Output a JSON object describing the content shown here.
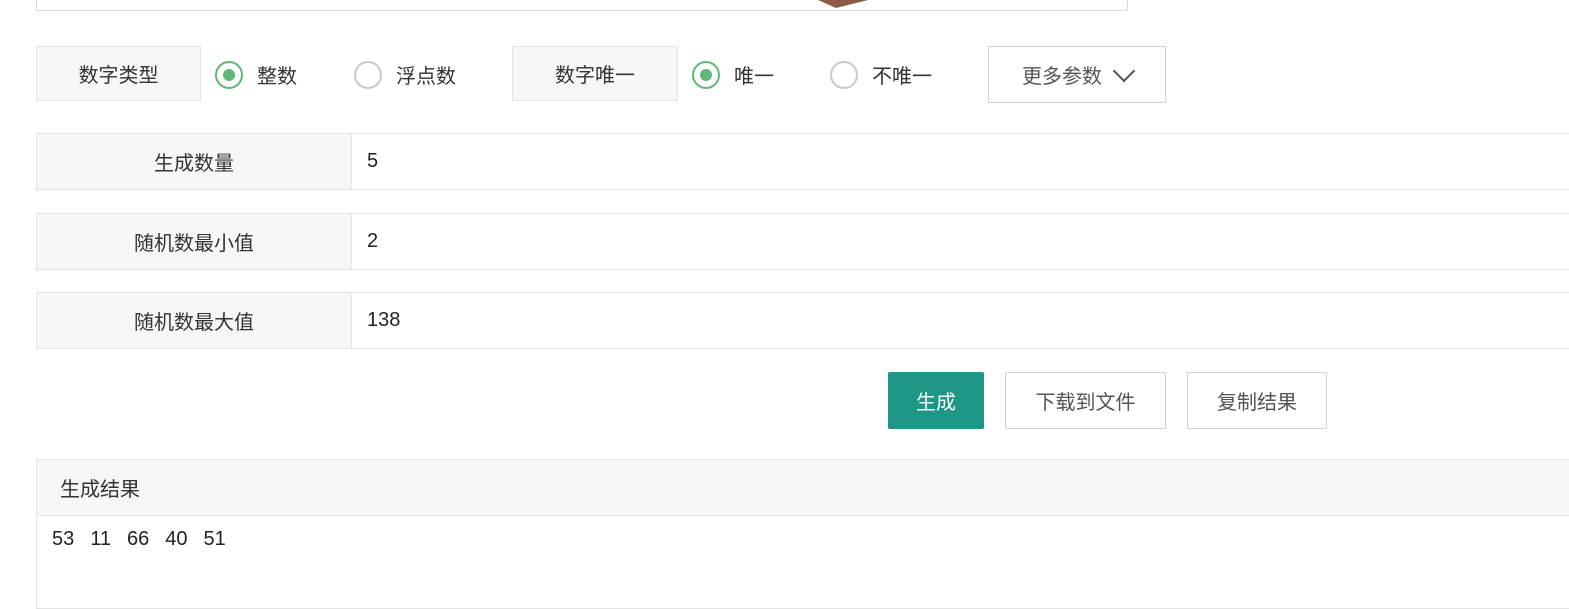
{
  "number_type": {
    "label": "数字类型",
    "options": [
      "整数",
      "浮点数"
    ],
    "selected": "整数"
  },
  "uniqueness": {
    "label": "数字唯一",
    "options": [
      "唯一",
      "不唯一"
    ],
    "selected": "唯一"
  },
  "more_params_label": "更多参数",
  "fields": {
    "count": {
      "label": "生成数量",
      "value": "5"
    },
    "min": {
      "label": "随机数最小值",
      "value": "2"
    },
    "max": {
      "label": "随机数最大值",
      "value": "138"
    }
  },
  "buttons": {
    "generate": "生成",
    "download": "下载到文件",
    "copy": "复制结果"
  },
  "result": {
    "title": "生成结果",
    "numbers": [
      "53",
      "11",
      "66",
      "40",
      "51"
    ]
  },
  "colors": {
    "accent_green": "#5fb878",
    "primary_button": "#1e9787"
  }
}
